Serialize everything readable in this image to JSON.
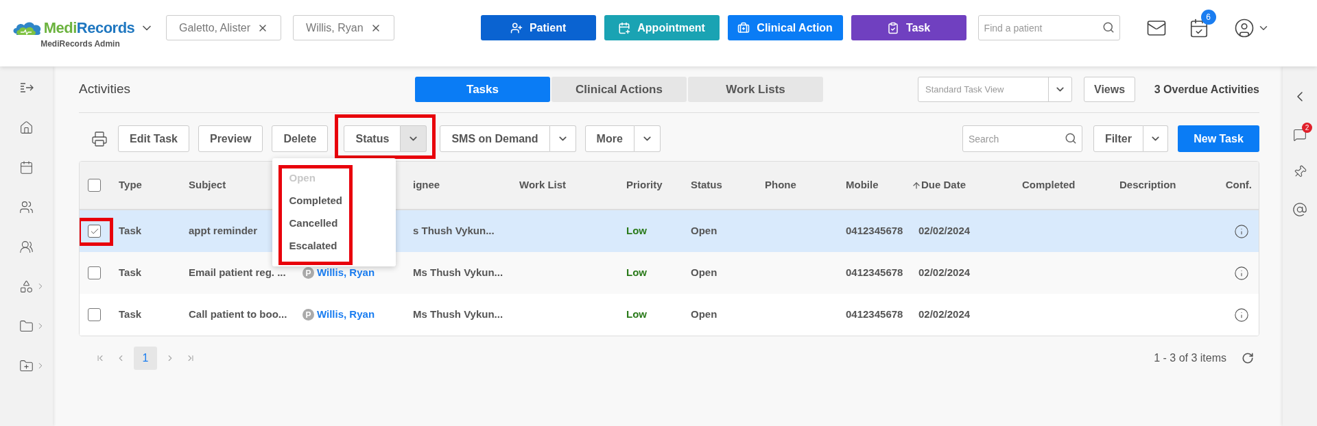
{
  "header": {
    "brand_parts": [
      "Medi",
      "Records"
    ],
    "brand_subtitle": "MediRecords Admin",
    "patient_tabs": [
      "Galetto, Alister",
      "Willis, Ryan"
    ],
    "actions": [
      {
        "label": "Patient",
        "kind": "patient"
      },
      {
        "label": "Appointment",
        "kind": "appointment"
      },
      {
        "label": "Clinical Action",
        "kind": "clinical"
      },
      {
        "label": "Task",
        "kind": "task"
      }
    ],
    "search": {
      "placeholder": "Find a patient"
    },
    "calendar_badge": "6"
  },
  "page": {
    "title": "Activities",
    "view_tabs": [
      {
        "label": "Tasks",
        "selected": true
      },
      {
        "label": "Clinical Actions",
        "selected": false
      },
      {
        "label": "Work Lists",
        "selected": false
      }
    ],
    "view_select": "Standard Task View",
    "views_button": "Views",
    "overdue": "3 Overdue Activities"
  },
  "toolbar": {
    "buttons": [
      {
        "label": "Edit Task",
        "kind": "plain"
      },
      {
        "label": "Preview",
        "kind": "plain"
      },
      {
        "label": "Delete",
        "kind": "plain"
      },
      {
        "label": "Status",
        "kind": "split",
        "open": true
      },
      {
        "label": "SMS on Demand",
        "kind": "split",
        "open": false
      },
      {
        "label": "More",
        "kind": "split",
        "open": false
      }
    ],
    "search": {
      "placeholder": "Search"
    },
    "filter": "Filter",
    "new_task": "New Task"
  },
  "status_menu": {
    "items": [
      {
        "label": "Open",
        "disabled": true
      },
      {
        "label": "Completed",
        "disabled": false
      },
      {
        "label": "Cancelled",
        "disabled": false
      },
      {
        "label": "Escalated",
        "disabled": false
      }
    ]
  },
  "table": {
    "all_checked": false,
    "columns": [
      {
        "label": "Type",
        "sorted": false
      },
      {
        "label": "Subject",
        "sorted": false
      },
      {
        "label": "ignee",
        "sorted": false
      },
      {
        "label": "Work List",
        "sorted": false
      },
      {
        "label": "Priority",
        "sorted": false
      },
      {
        "label": "Status",
        "sorted": false
      },
      {
        "label": "Phone",
        "sorted": false
      },
      {
        "label": "Mobile",
        "sorted": false
      },
      {
        "label": "Due Date",
        "sorted": true
      },
      {
        "label": "Completed",
        "sorted": false
      },
      {
        "label": "Description",
        "sorted": false
      },
      {
        "label": "Conf.",
        "sorted": false
      }
    ],
    "rows": [
      {
        "checked": true,
        "selected": true,
        "type": "Task",
        "subject": "appt reminder",
        "assignee": "s Thush Vykun...",
        "priority": "Low",
        "status": "Open",
        "mobile": "0412345678",
        "due_date": "02/02/2024"
      },
      {
        "checked": false,
        "selected": false,
        "type": "Task",
        "subject": "Email patient reg. ...",
        "patient": "Willis, Ryan",
        "patient_badge": "P",
        "assignee": "Ms Thush Vykun...",
        "priority": "Low",
        "status": "Open",
        "mobile": "0412345678",
        "due_date": "02/02/2024"
      },
      {
        "checked": false,
        "selected": false,
        "type": "Task",
        "subject": "Call patient to boo...",
        "patient": "Willis, Ryan",
        "patient_badge": "P",
        "assignee": "Ms Thush Vykun...",
        "priority": "Low",
        "status": "Open",
        "mobile": "0412345678",
        "due_date": "02/02/2024"
      }
    ]
  },
  "pagination": {
    "pages": [
      {
        "label": "1",
        "selected": true
      }
    ],
    "summary": "1 - 3 of 3 items"
  },
  "right_panel": {
    "chat_badge": "2"
  }
}
